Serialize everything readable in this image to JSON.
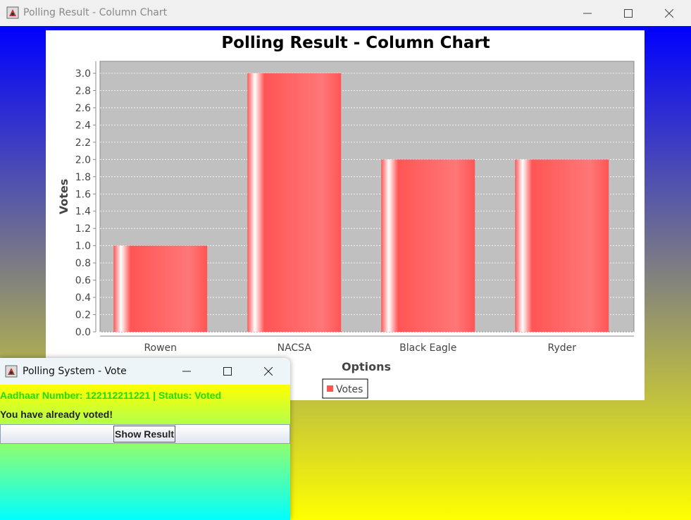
{
  "main_window": {
    "title": "Polling Result - Column Chart",
    "controls": [
      "minimize",
      "maximize",
      "close"
    ]
  },
  "chart_data": {
    "type": "bar",
    "title": "Polling Result - Column Chart",
    "xlabel": "Options",
    "ylabel": "Votes",
    "categories": [
      "Rowen",
      "NACSA",
      "Black Eagle",
      "Ryder"
    ],
    "series": [
      {
        "name": "Votes",
        "values": [
          1,
          3,
          2,
          2
        ],
        "color": "#ff5555"
      }
    ],
    "ylim": [
      0,
      3.0
    ],
    "yticks": [
      "0.0",
      "0.2",
      "0.4",
      "0.6",
      "0.8",
      "1.0",
      "1.2",
      "1.4",
      "1.6",
      "1.8",
      "2.0",
      "2.2",
      "2.4",
      "2.6",
      "2.8",
      "3.0"
    ],
    "grid": true,
    "legend": "bottom-center",
    "plot_background": "#c0c0c0"
  },
  "vote_window": {
    "title": "Polling System - Vote",
    "status_text": "Aadhaar Number: 122112211221 | Status: Voted",
    "message": "You have already voted!",
    "show_result_label": "Show Result"
  },
  "colors": {
    "status_green": "#22dd00",
    "bar_red": "#ff5555"
  }
}
